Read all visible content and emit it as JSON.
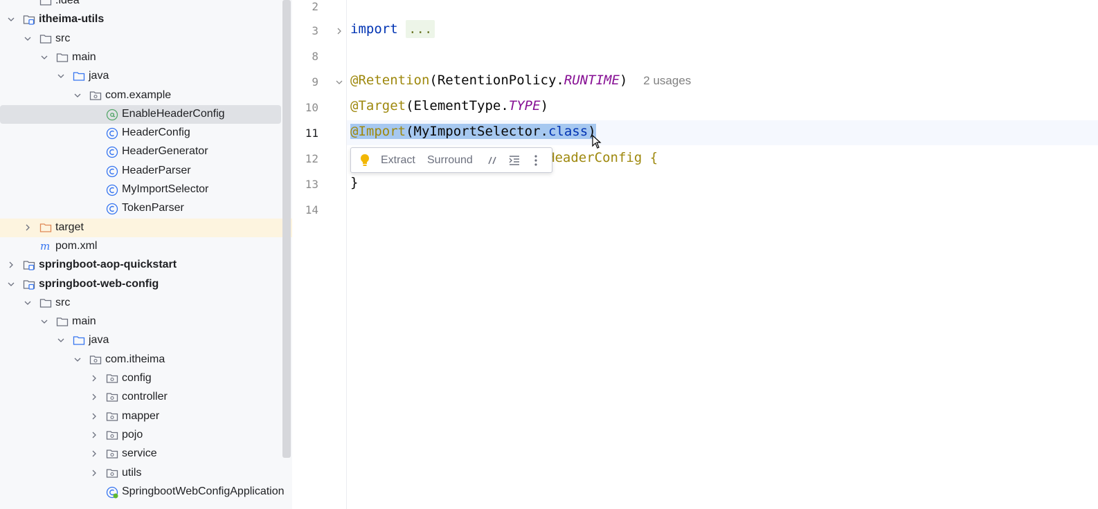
{
  "project_tree": {
    "items": [
      {
        "label": ".idea",
        "kind": "folder",
        "indent": 1,
        "expanded": null
      },
      {
        "label": "itheima-utils",
        "kind": "module",
        "indent": 0,
        "expanded": true,
        "bold": true
      },
      {
        "label": "src",
        "kind": "folder",
        "indent": 1,
        "expanded": true
      },
      {
        "label": "main",
        "kind": "folder",
        "indent": 2,
        "expanded": true
      },
      {
        "label": "java",
        "kind": "source-folder",
        "indent": 3,
        "expanded": true
      },
      {
        "label": "com.example",
        "kind": "package",
        "indent": 4,
        "expanded": true
      },
      {
        "label": "EnableHeaderConfig",
        "kind": "annotation",
        "indent": 5,
        "expanded": null,
        "selected": true
      },
      {
        "label": "HeaderConfig",
        "kind": "class",
        "indent": 5,
        "expanded": null
      },
      {
        "label": "HeaderGenerator",
        "kind": "class",
        "indent": 5,
        "expanded": null
      },
      {
        "label": "HeaderParser",
        "kind": "class",
        "indent": 5,
        "expanded": null
      },
      {
        "label": "MyImportSelector",
        "kind": "class",
        "indent": 5,
        "expanded": null
      },
      {
        "label": "TokenParser",
        "kind": "class",
        "indent": 5,
        "expanded": null
      },
      {
        "label": "target",
        "kind": "excluded-folder",
        "indent": 1,
        "expanded": false
      },
      {
        "label": "pom.xml",
        "kind": "maven",
        "indent": 1,
        "expanded": null
      },
      {
        "label": "springboot-aop-quickstart",
        "kind": "module",
        "indent": 0,
        "expanded": false,
        "bold": true
      },
      {
        "label": "springboot-web-config",
        "kind": "module",
        "indent": 0,
        "expanded": true,
        "bold": true
      },
      {
        "label": "src",
        "kind": "folder",
        "indent": 1,
        "expanded": true
      },
      {
        "label": "main",
        "kind": "folder",
        "indent": 2,
        "expanded": true
      },
      {
        "label": "java",
        "kind": "source-folder",
        "indent": 3,
        "expanded": true
      },
      {
        "label": "com.itheima",
        "kind": "package",
        "indent": 4,
        "expanded": true
      },
      {
        "label": "config",
        "kind": "package",
        "indent": 5,
        "expanded": false
      },
      {
        "label": "controller",
        "kind": "package",
        "indent": 5,
        "expanded": false
      },
      {
        "label": "mapper",
        "kind": "package",
        "indent": 5,
        "expanded": false
      },
      {
        "label": "pojo",
        "kind": "package",
        "indent": 5,
        "expanded": false
      },
      {
        "label": "service",
        "kind": "package",
        "indent": 5,
        "expanded": false
      },
      {
        "label": "utils",
        "kind": "package",
        "indent": 5,
        "expanded": false
      },
      {
        "label": "SpringbootWebConfigApplication",
        "kind": "spring-class",
        "indent": 5,
        "expanded": null
      }
    ]
  },
  "editor": {
    "line_numbers": [
      "2",
      "3",
      "8",
      "9",
      "10",
      "11",
      "12",
      "13",
      "14"
    ],
    "current_line": "11",
    "code": {
      "import_kw": "import",
      "import_fold": "...",
      "retention_ann": "@Retention",
      "retention_open": "(RetentionPolicy.",
      "retention_const": "RUNTIME",
      "retention_close": ")",
      "usages_hint": "2 usages",
      "target_ann": "@Target",
      "target_open": "(ElementType.",
      "target_const": "TYPE",
      "target_close": ")",
      "import_ann": "@Import",
      "import_open": "(MyImportSelector.",
      "import_class_kw": "class",
      "import_close": ")",
      "line12_tail": "HeaderConfig {",
      "line13": "}"
    },
    "popup": {
      "extract": "Extract",
      "surround": "Surround"
    }
  },
  "colors": {
    "keyword": "#0033b3",
    "annotation": "#9e880d",
    "constant": "#871094",
    "selection": "#a6c8f0"
  }
}
